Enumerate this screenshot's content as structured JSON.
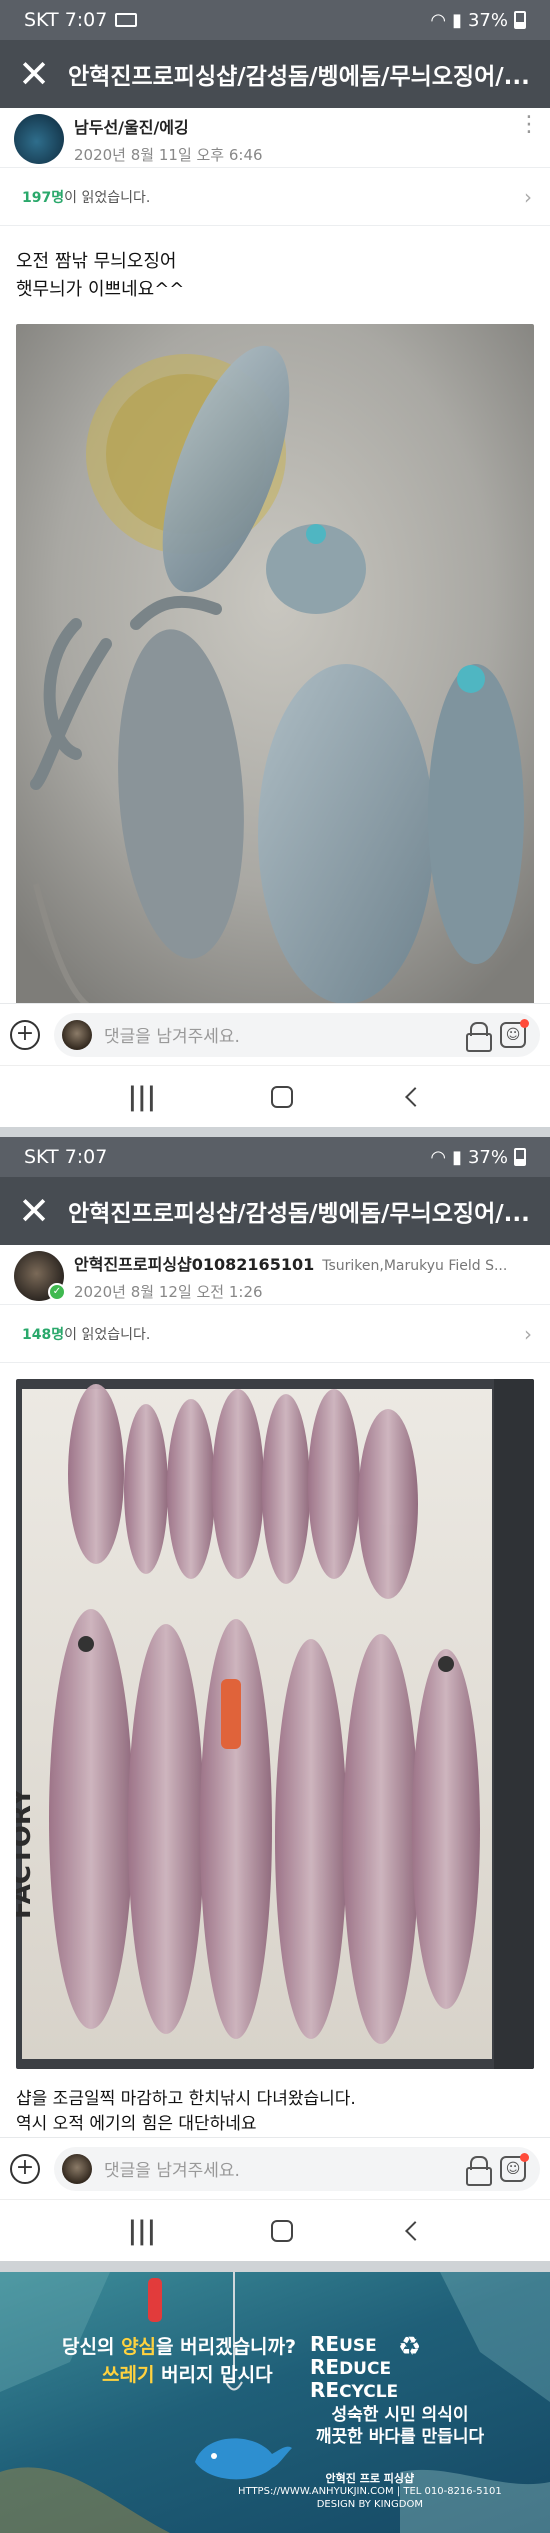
{
  "screens": [
    {
      "status": {
        "carrier_time": "SKT 7:07",
        "battery": "37%"
      },
      "appbar": {
        "title": "안혁진프로피싱샵/감성돔/벵에돔/무늬오징어/..."
      },
      "author": {
        "name": "남두선/울진/에깅",
        "date": "2020년 8월 11일 오후 6:46",
        "extra": ""
      },
      "read": {
        "count": "197명",
        "suffix": "이 읽었습니다."
      },
      "post_lines": [
        "오전 짬낚 무늬오징어",
        "햇무늬가 이쁘네요^^"
      ],
      "comment_placeholder": "댓글을 남겨주세요."
    },
    {
      "status": {
        "carrier_time": "SKT 7:07",
        "battery": "37%"
      },
      "appbar": {
        "title": "안혁진프로피싱샵/감성돔/벵에돔/무늬오징어/..."
      },
      "author": {
        "name": "안혁진프로피싱샵01082165101",
        "date": "2020년 8월 12일 오전 1:26",
        "extra": "Tsuriken,Marukyu Field S..."
      },
      "read": {
        "count": "148명",
        "suffix": "이 읽었습니다."
      },
      "post_lines": [
        "샵을 조금일찍 마감하고 한치낚시 다녀왔습니다.",
        "역시 오적 에기의 힘은 대단하네요"
      ],
      "comment_placeholder": "댓글을 남겨주세요."
    }
  ],
  "banner": {
    "line1_pre": "당신의 ",
    "line1_hl": "양심",
    "line1_post": "을 버리겠습니까?",
    "line2_hl": "쓰레기",
    "line2_post": " 버리지 맙시다",
    "recycle": [
      "RE",
      "USE",
      "RE",
      "DUCE",
      "RE",
      "CYCLE"
    ],
    "sub_line1": "성숙한 시민 의식이",
    "sub_line2": "깨끗한 바다를 만듭니다",
    "credit_name": "안혁진 프로 피싱샵",
    "credit_tel": "HTTPS://WWW.ANHYUKJIN.COM | TEL 010-8216-5101",
    "credit_design": "DESIGN BY KINGDOM"
  },
  "colors": {
    "appbar": "#474c52",
    "statusbar": "#5a5f66",
    "read_count": "#2aa86b",
    "banner_highlight": "#ffd23f"
  }
}
